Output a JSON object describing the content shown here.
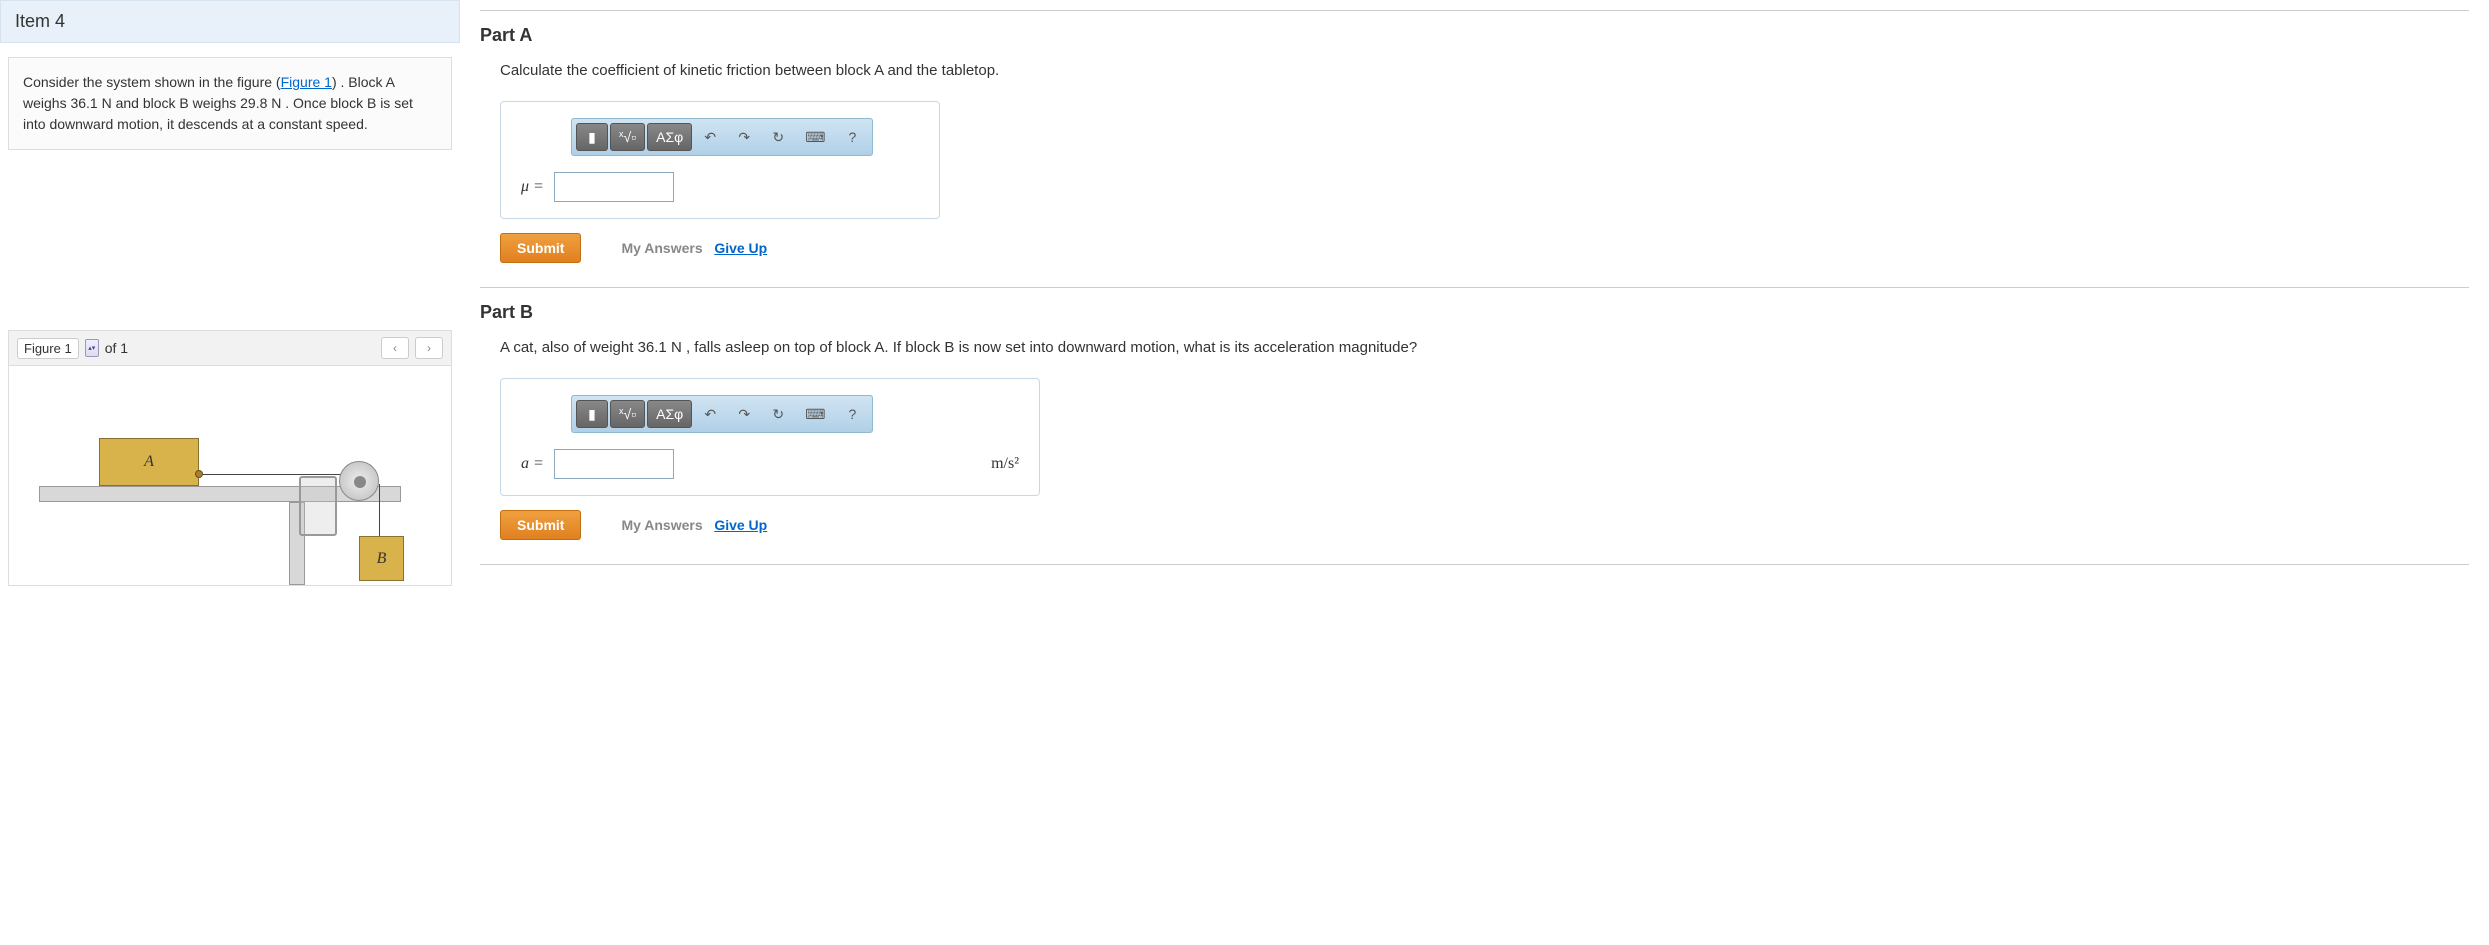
{
  "item_header": "Item 4",
  "problem": {
    "pre": "Consider the system shown in the figure (",
    "link": "Figure 1",
    "post": ") . Block A weighs 36.1 N and block B weighs 29.8 N . Once block B is set into downward motion, it descends at a constant speed."
  },
  "figure_bar": {
    "select": "Figure 1",
    "count": "of 1"
  },
  "blocks": {
    "a": "A",
    "b": "B"
  },
  "partA": {
    "label": "Part A",
    "prompt": "Calculate the coefficient of kinetic friction between block A and the tabletop.",
    "var": "μ =",
    "submit": "Submit",
    "myans": "My Answers",
    "giveup": "Give Up"
  },
  "partB": {
    "label": "Part B",
    "prompt": "A cat, also of weight 36.1 N , falls asleep on top of block A. If block B is now set into downward motion, what is its acceleration magnitude?",
    "var": "a =",
    "units": "m/s²",
    "submit": "Submit",
    "myans": "My Answers",
    "giveup": "Give Up"
  },
  "toolbar": {
    "templates": "√x",
    "greek": "ΑΣφ",
    "undo": "↶",
    "redo": "↷",
    "reset": "↻",
    "keyboard": "⌨",
    "help": "?"
  }
}
